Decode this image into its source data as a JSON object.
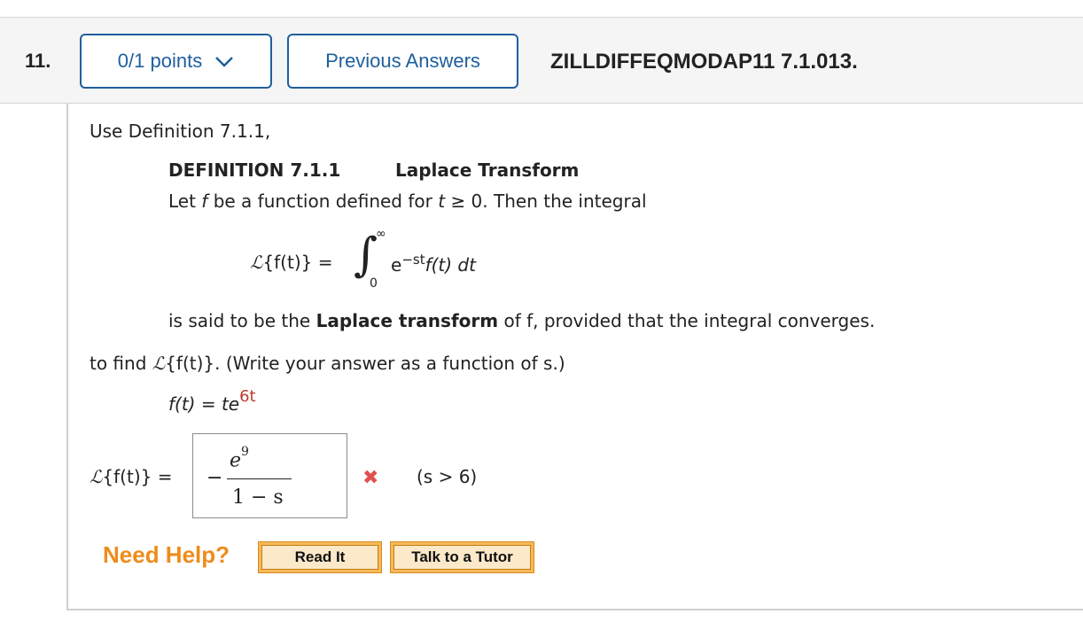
{
  "header": {
    "question_number": "11.",
    "points_label": "0/1 points",
    "previous_answers_label": "Previous Answers",
    "question_id": "ZILLDIFFEQMODAP11 7.1.013."
  },
  "problem": {
    "intro": "Use Definition 7.1.1,",
    "definition_number": "DEFINITION 7.1.1",
    "definition_title": "Laplace Transform",
    "def_line_1": "Let",
    "def_line_f": "f",
    "def_line_2": "be a function defined for",
    "def_line_t": "t",
    "def_line_3": "≥ 0. Then the integral",
    "transform_symbol": "ℒ",
    "transform_lhs": "{f(t)} =",
    "integral_sign": "∫",
    "integral_upper": "∞",
    "integral_lower": "0",
    "integrand_e": "e",
    "integrand_exp": "−st",
    "integrand_rest": "f(t) dt",
    "said_prefix": "is said to be the",
    "said_bold": "Laplace transform",
    "said_suffix": "of f, provided that the integral converges.",
    "task_prefix": "to find",
    "task_symbol": "ℒ",
    "task_middle": "{f(t)}. (Write your answer as a function of s.)",
    "ft_lhs": "f(t) = te",
    "ft_exp": "6t"
  },
  "answer": {
    "lhs_symbol": "ℒ",
    "lhs": "{f(t)} =",
    "sign": "−",
    "numerator_base": "e",
    "numerator_exp": "9",
    "denominator": "1 − s",
    "condition": "(s > 6)",
    "status_icon": "x-mark-icon",
    "status": "incorrect",
    "status_color": "#e05050"
  },
  "help": {
    "label": "Need Help?",
    "read_it": "Read It",
    "talk_to_tutor": "Talk to a Tutor"
  }
}
